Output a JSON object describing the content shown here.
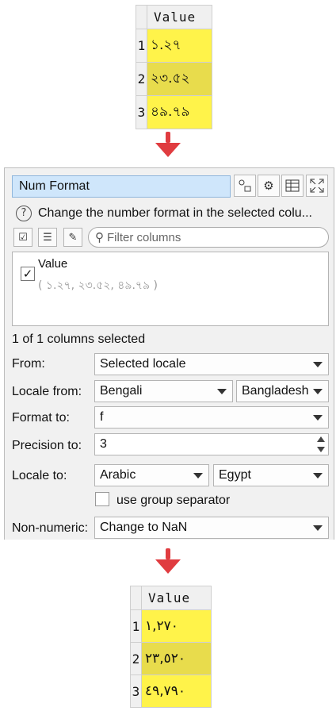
{
  "top_table": {
    "header": "Value",
    "rows": [
      {
        "num": "1",
        "value": "১.২৭",
        "color": "#fff34a"
      },
      {
        "num": "2",
        "value": "২৩.৫২",
        "color": "#e8dc4c"
      },
      {
        "num": "3",
        "value": "৪৯.৭৯",
        "color": "#fff34a"
      }
    ]
  },
  "panel": {
    "title": "Num Format",
    "help_icon": "?",
    "help_text": "Change the number format in the selected colu...",
    "filter_placeholder": "Filter columns",
    "column": {
      "name": "Value",
      "sample": "( ১.২৭, ২৩.৫২, ৪৯.৭৯ )",
      "checked": true
    },
    "status": "1 of 1 columns selected",
    "from_label": "From:",
    "from_value": "Selected locale",
    "locale_from_label": "Locale from:",
    "locale_from_language": "Bengali",
    "locale_from_country": "Bangladesh",
    "format_to_label": "Format to:",
    "format_to_value": "f",
    "precision_label": "Precision to:",
    "precision_value": "3",
    "locale_to_label": "Locale to:",
    "locale_to_language": "Arabic",
    "locale_to_country": "Egypt",
    "group_separator_label": "use group separator",
    "non_numeric_label": "Non-numeric:",
    "non_numeric_value": "Change to NaN"
  },
  "bottom_table": {
    "header": "Value",
    "rows": [
      {
        "num": "1",
        "value": "١,٢٧٠",
        "color": "#fff34a"
      },
      {
        "num": "2",
        "value": "٢٣,٥٢٠",
        "color": "#e8dc4c"
      },
      {
        "num": "3",
        "value": "٤٩,٧٩٠",
        "color": "#fff34a"
      }
    ]
  },
  "colors": {
    "arrow": "#e03c40",
    "cell_yellow": "#fff34a",
    "cell_yellow_dark": "#e8dc4c",
    "title_bg": "#cfe6fb"
  }
}
